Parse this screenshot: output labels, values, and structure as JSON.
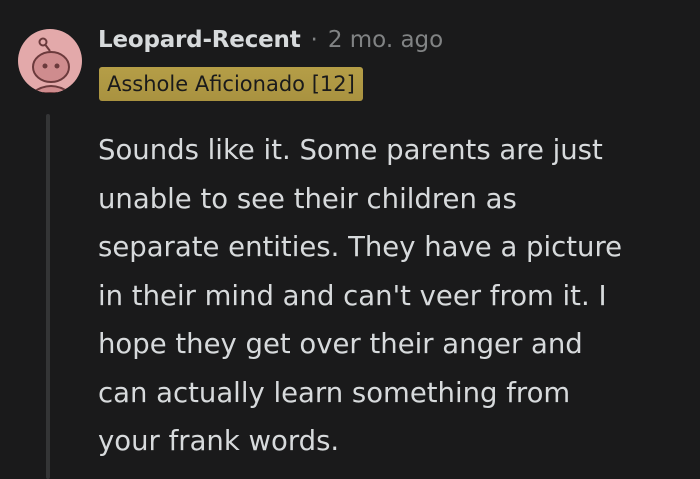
{
  "comment": {
    "author": "Leopard-Recent",
    "separator": "·",
    "timestamp": "2 mo. ago",
    "flair": "Asshole Aficionado [12]",
    "body_lines": [
      "Sounds like it. Some parents are just",
      "unable to see their children as",
      "separate entities. They have a picture",
      "in their mind and can't veer from it. I",
      "hope they get over their anger and",
      "can actually learn something from",
      "your frank words."
    ]
  },
  "colors": {
    "background": "#1a1a1b",
    "text": "#d7dadc",
    "muted": "#818384",
    "flair_bg": "#b09a42",
    "avatar_bg": "#e3a9aa"
  },
  "icons": {
    "avatar": "reddit-snoo-avatar-icon"
  }
}
